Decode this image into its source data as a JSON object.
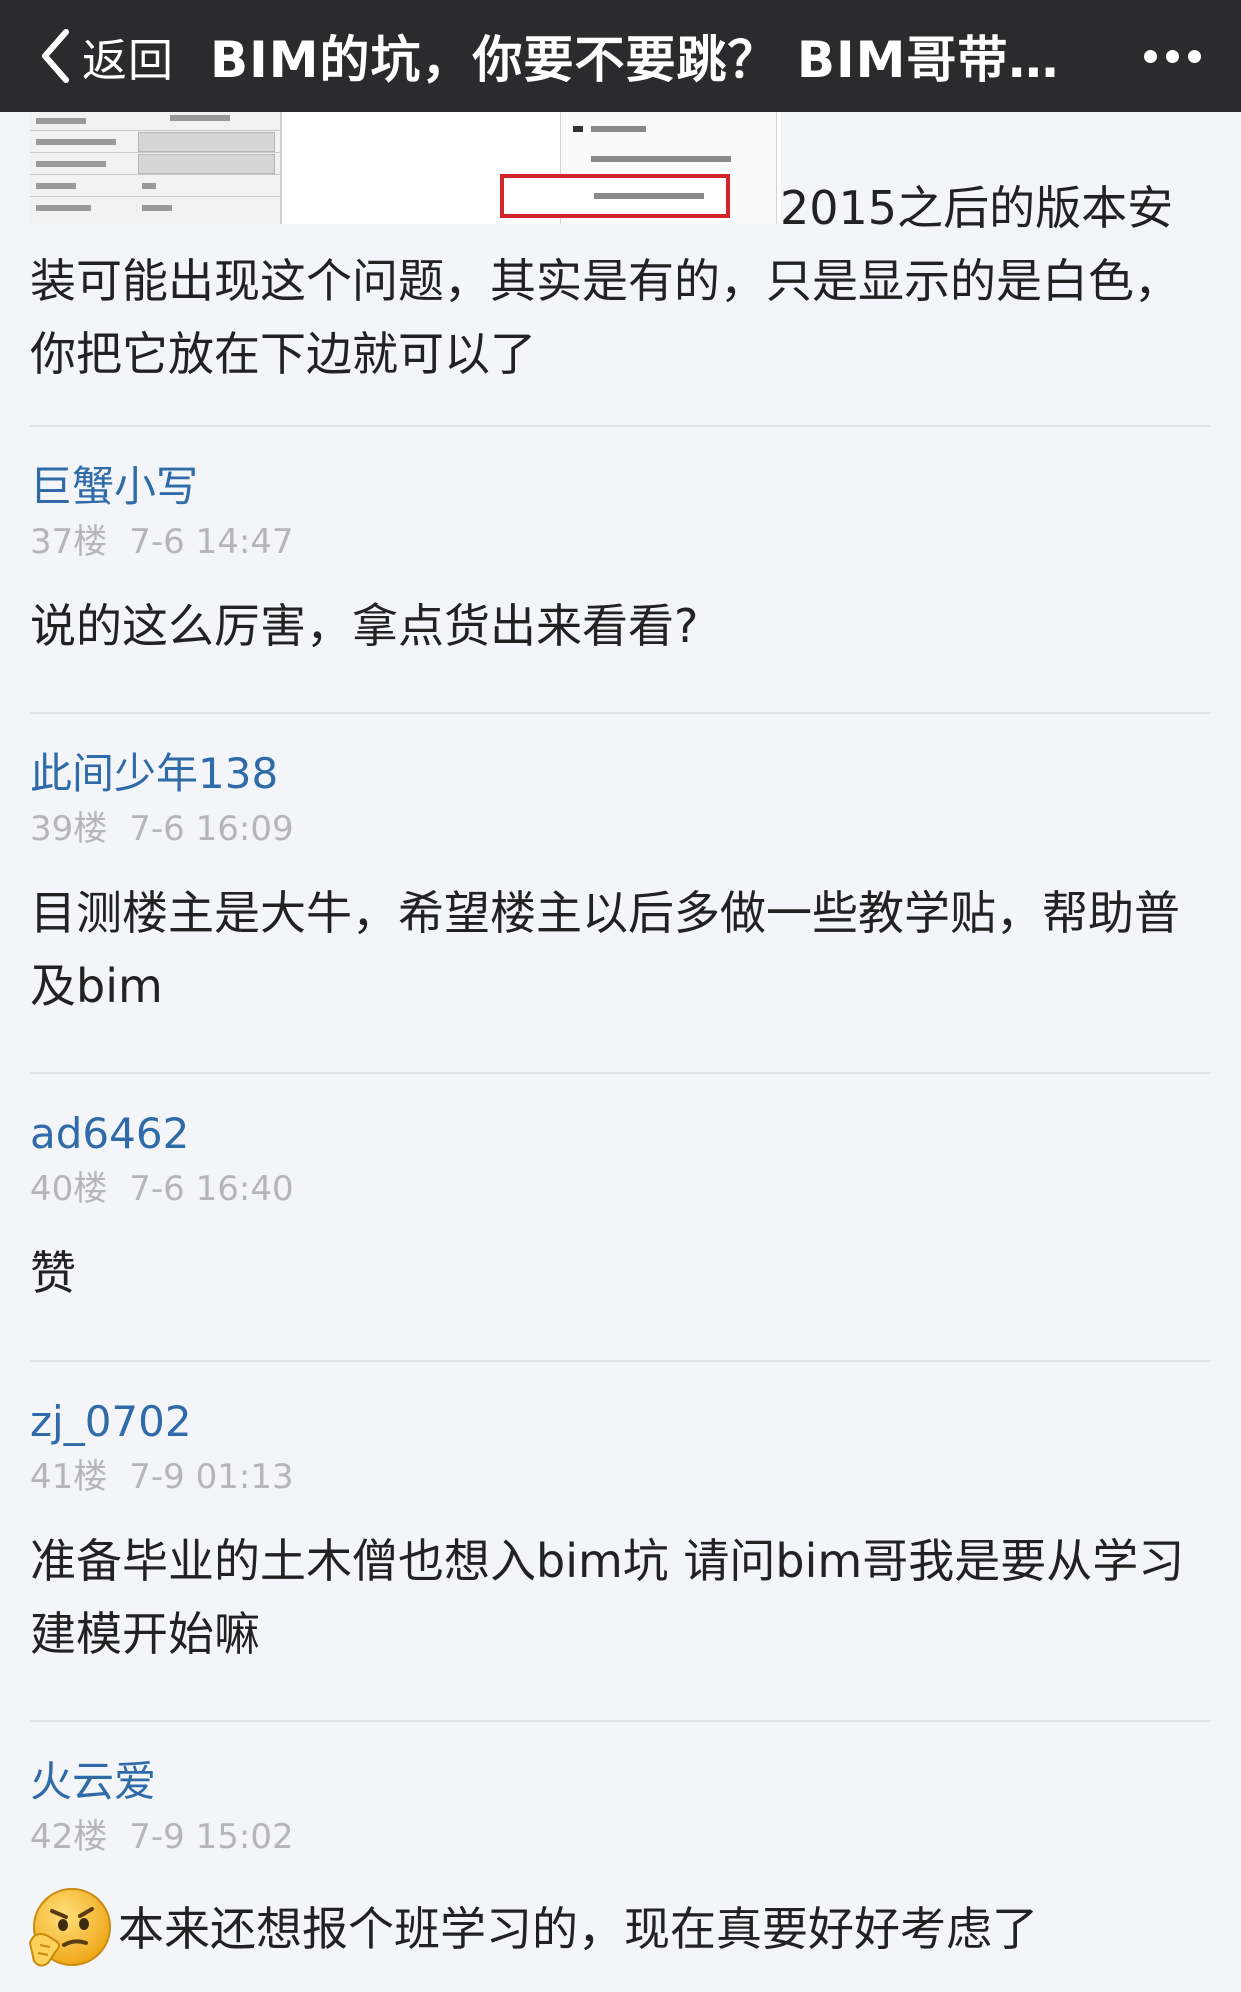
{
  "nav": {
    "back_label": "返回",
    "title": "BIM的坑，你要不要跳？ BIM哥带…"
  },
  "top_post": {
    "text": "2015之后的版本安装可能出现这个问题，其实是有的，只是显示的是白色，你把它放在下边就可以了"
  },
  "posts": [
    {
      "user": "巨蟹小写",
      "floor": "37楼",
      "time": "7-6 14:47",
      "text": "说的这么厉害，拿点货出来看看?"
    },
    {
      "user": "此间少年138",
      "floor": "39楼",
      "time": "7-6 16:09",
      "text": "目测楼主是大牛，希望楼主以后多做一些教学贴，帮助普及bim"
    },
    {
      "user": "ad6462",
      "floor": "40楼",
      "time": "7-6 16:40",
      "text": "赞"
    },
    {
      "user": "zj_0702",
      "floor": "41楼",
      "time": "7-9 01:13",
      "text": "准备毕业的土木僧也想入bim坑 请问bim哥我是要从学习建模开始嘛"
    },
    {
      "user": "火云爱",
      "floor": "42楼",
      "time": "7-9 15:02",
      "text": "本来还想报个班学习的，现在真要好好考虑了"
    }
  ],
  "icons": {
    "back": "chevron-left-icon",
    "more": "more-dots-icon",
    "emoji": "thinking-face-emoji-icon"
  },
  "colors": {
    "navbar_bg": "#2b2b2d",
    "username": "#2f6ba8",
    "meta": "#b5b5ba",
    "body_text": "#222222",
    "page_bg": "#f4f5f9",
    "highlight_red": "#d6242b"
  }
}
